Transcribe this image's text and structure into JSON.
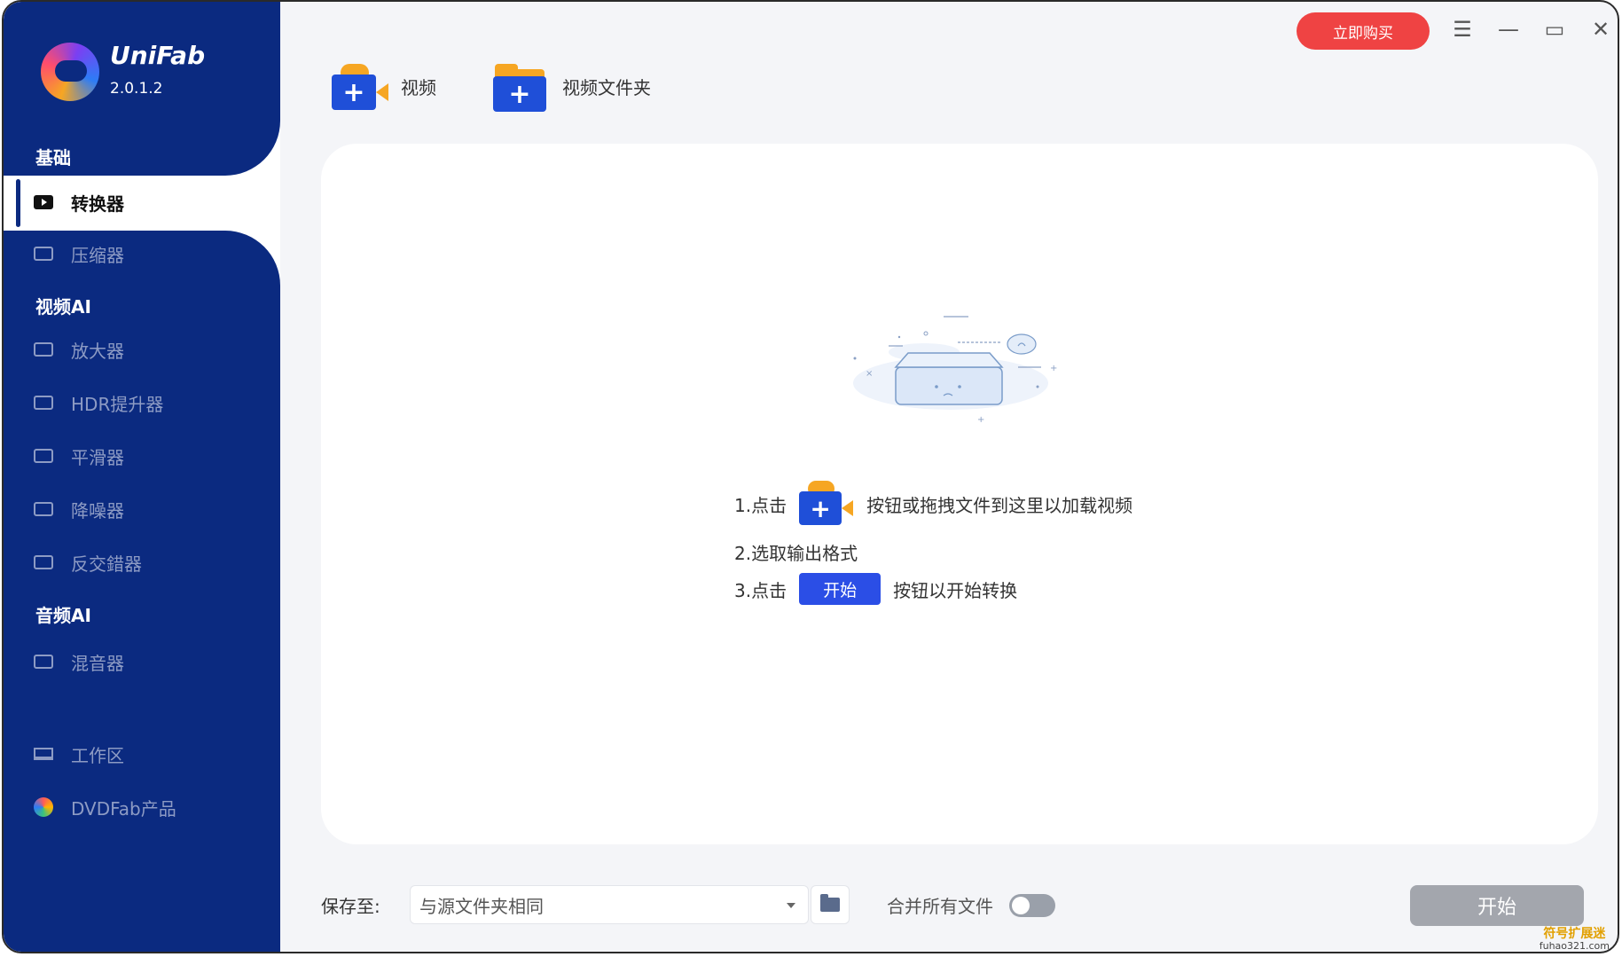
{
  "app": {
    "name": "UniFab",
    "version": "2.0.1.2"
  },
  "titlebar": {
    "buy_label": "立即购买",
    "menu_glyph": "☰",
    "minimize_glyph": "—",
    "maximize_glyph": "▭",
    "close_glyph": "✕"
  },
  "sidebar": {
    "sections": [
      {
        "title": "基础"
      },
      {
        "title": "视频AI"
      },
      {
        "title": "音频AI"
      }
    ],
    "items": [
      {
        "label": "转换器",
        "icon": "play-icon",
        "active": true
      },
      {
        "label": "压缩器",
        "icon": "compress-icon"
      },
      {
        "label": "放大器",
        "icon": "upscale-icon"
      },
      {
        "label": "HDR提升器",
        "icon": "hdr-icon"
      },
      {
        "label": "平滑器",
        "icon": "smooth-icon"
      },
      {
        "label": "降噪器",
        "icon": "denoise-icon"
      },
      {
        "label": "反交錯器",
        "icon": "deinterlace-icon"
      },
      {
        "label": "混音器",
        "icon": "mixer-icon"
      },
      {
        "label": "工作区",
        "icon": "monitor-icon"
      },
      {
        "label": "DVDFab产品",
        "icon": "dvdfab-icon"
      }
    ]
  },
  "toolbar": {
    "add_video_label": "视频",
    "add_folder_label": "视频文件夹"
  },
  "drop_area": {
    "step1_prefix": "1.点击",
    "step1_suffix": "按钮或拖拽文件到这里以加载视频",
    "step2": "2.选取输出格式",
    "step3_prefix": "3.点击",
    "step3_chip": "开始",
    "step3_suffix": "按钮以开始转换"
  },
  "bottom": {
    "save_label": "保存至:",
    "save_value": "与源文件夹相同",
    "merge_label": "合并所有文件",
    "merge_enabled": false,
    "start_label": "开始"
  },
  "watermark": {
    "line1": "符号扩展迷",
    "line2": "fuhao321.com"
  },
  "colors": {
    "sidebar": "#0b2a80",
    "accent": "#1f4fd8",
    "buy": "#ef4343",
    "start_disabled": "#a3a6ad"
  }
}
